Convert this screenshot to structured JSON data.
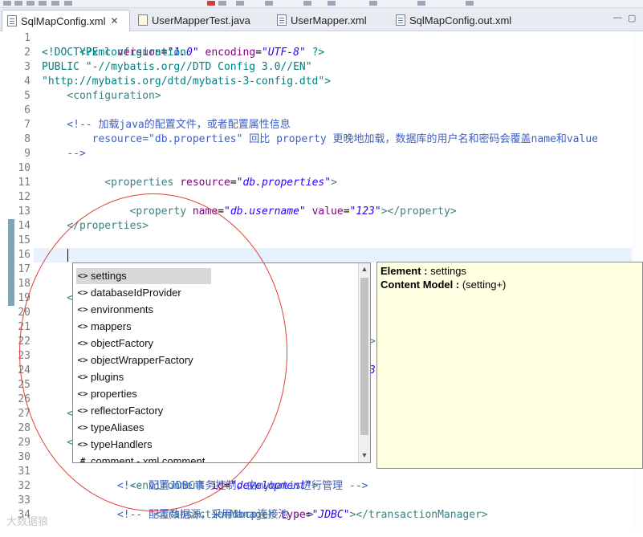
{
  "tabs": [
    {
      "label": "SqlMapConfig.xml",
      "active": true,
      "icon": "xml-file-icon",
      "closable": true
    },
    {
      "label": "UserMapperTest.java",
      "active": false,
      "icon": "java-file-icon"
    },
    {
      "label": "UserMapper.xml",
      "active": false,
      "icon": "xml-file-icon"
    },
    {
      "label": "SqlMapConfig.out.xml",
      "active": false,
      "icon": "xml-file-icon"
    }
  ],
  "close_glyph": "✕",
  "window_controls": {
    "minimize": "—",
    "maximize": "▢"
  },
  "line_numbers": [
    "1",
    "2",
    "3",
    "4",
    "5",
    "6",
    "7",
    "8",
    "9",
    "10",
    "11",
    "12",
    "13",
    "14",
    "15",
    "16",
    "17",
    "18",
    "19",
    "20",
    "21",
    "22",
    "23",
    "24",
    "25",
    "26",
    "27",
    "28",
    "29",
    "30",
    "31",
    "32",
    "33",
    "34"
  ],
  "code": {
    "l1": {
      "a": "<?xml ",
      "b": "version",
      "c": "=",
      "d": "\"1.0\"",
      "e": " encoding",
      "f": "=",
      "g": "\"UTF-8\"",
      "h": " ?>"
    },
    "l2": "<!DOCTYPE configuration",
    "l3": "PUBLIC \"-//mybatis.org//DTD Config 3.0//EN\"",
    "l4": "\"http://mybatis.org/dtd/mybatis-3-config.dtd\">",
    "l5": "    <configuration>",
    "l7": "    <!-- 加载java的配置文件，或者配置属性信息",
    "l8": "        resource=\"db.properties\" 回比 property 更晚地加载，数据库的用户名和密码会覆盖name和value",
    "l9": "    -->",
    "l10": {
      "a": "    <properties ",
      "b": "resource",
      "c": "=",
      "d": "\"db.properties\"",
      "e": ">"
    },
    "l12": {
      "a": "        <property ",
      "b": "name",
      "c": "=",
      "d": "\"db.username\"",
      "e": " value",
      "f": "=",
      "g": "\"123\"",
      "h": "></property>"
    },
    "l14": "    </properties>",
    "l19": "    <",
    "l27": "    <",
    "l29": "    <",
    "l31": {
      "a": "        <environment ",
      "b": "id",
      "c": "=",
      "d": "\"development\"",
      "e": ">"
    },
    "l32": "            <!-- 配置JDBC事务控制，由mybatis进行管理 -->",
    "l33": {
      "a": "            <transactionManager ",
      "b": "type",
      "c": "=",
      "d": "\"JDBC\"",
      "e": "></transactionManager>"
    },
    "l34": "            <!-- 配置数据源，采用dbcp连接池 -->",
    "peek_22": ">",
    "peek_24": "3"
  },
  "assist": {
    "items": [
      {
        "icon": "<>",
        "label": "settings",
        "selected": true
      },
      {
        "icon": "<>",
        "label": "databaseIdProvider"
      },
      {
        "icon": "<>",
        "label": "environments"
      },
      {
        "icon": "<>",
        "label": "mappers"
      },
      {
        "icon": "<>",
        "label": "objectFactory"
      },
      {
        "icon": "<>",
        "label": "objectWrapperFactory"
      },
      {
        "icon": "<>",
        "label": "plugins"
      },
      {
        "icon": "<>",
        "label": "properties"
      },
      {
        "icon": "<>",
        "label": "reflectorFactory"
      },
      {
        "icon": "<>",
        "label": "typeAliases"
      },
      {
        "icon": "<>",
        "label": "typeHandlers"
      },
      {
        "icon": "#",
        "label": "comment - xml comment"
      }
    ],
    "scroll_up": "▲",
    "scroll_down": "▼"
  },
  "info": {
    "element_key": "Element : ",
    "element_val": "settings",
    "content_key": "Content Model : ",
    "content_val": "(setting+)"
  },
  "watermark": "大数据狼",
  "colors": {
    "annotation_circle": "#e0403a",
    "current_line": "#e8f2fe",
    "info_bg": "#ffffe1",
    "change_marker": "#7fa6b3"
  }
}
